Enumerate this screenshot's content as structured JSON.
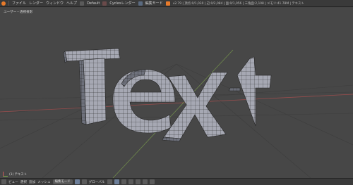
{
  "topbar": {
    "menus": [
      "ファイル",
      "レンダー",
      "ウィンドウ",
      "ヘルプ"
    ],
    "layout": "Default",
    "engine": "Cyclesレンダー",
    "editor_mode": "編集モード",
    "stats": "v2.79 | 頂点:0/1,030 | 辺:0/2,084 | 面:0/1,056 | 三角面:2,108 | メモリ:41.78M | テキスト"
  },
  "viewport": {
    "label": "ユーザー・透視投影",
    "object_name": "(1) テキスト",
    "text": "Text"
  },
  "bottombar": {
    "items": [
      "ビュー",
      "選択",
      "追加",
      "メッシュ"
    ],
    "mode": "編集モード",
    "pivot": "グローバル"
  },
  "colors": {
    "background": "#474747",
    "mesh_face": "#a6a8b3",
    "mesh_face_dark": "#6e717c",
    "wire": "#262626",
    "accent": "#e77a2a"
  }
}
